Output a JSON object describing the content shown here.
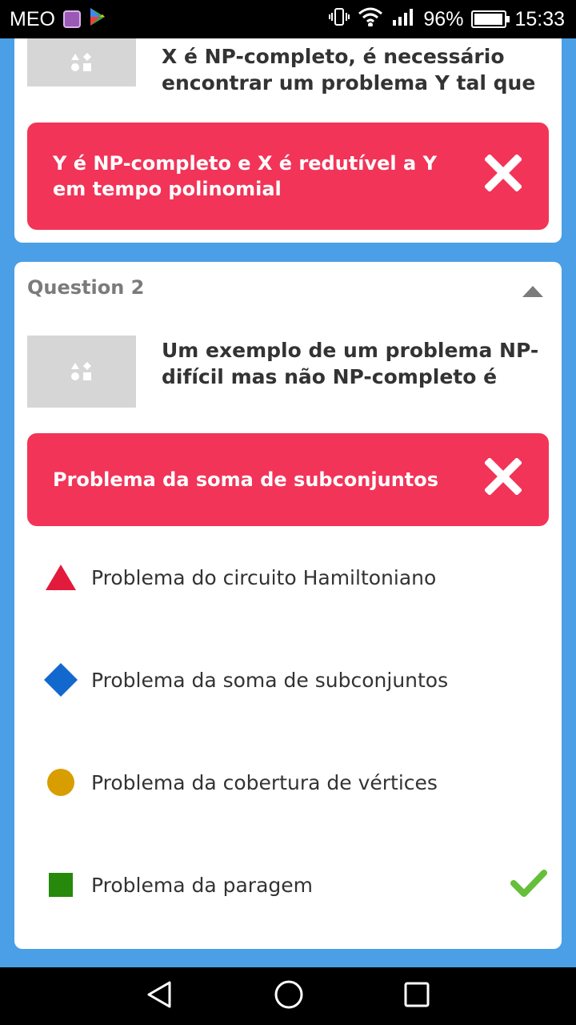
{
  "status_bar": {
    "carrier": "MEO",
    "battery": "96%",
    "battery_level": 0.96,
    "time": "15:33"
  },
  "question1": {
    "text_line1": "X é NP-completo, é necessário",
    "text_line2": "encontrar um problema Y tal que",
    "answer": "Y é NP-completo e X é redutível a Y em tempo polinomial",
    "answer_correct": false
  },
  "question2": {
    "header": "Question 2",
    "text": "Um exemplo de um problema NP-difícil mas não NP-completo é",
    "answer": "Problema da soma de subconjuntos",
    "answer_correct": false,
    "options": [
      {
        "label": "Problema do circuito Hamiltoniano",
        "shape": "triangle",
        "color": "#e21b3c",
        "correct": false
      },
      {
        "label": "Problema da soma de subconjuntos",
        "shape": "diamond",
        "color": "#1368ce",
        "correct": false
      },
      {
        "label": "Problema da cobertura de vértices",
        "shape": "circle",
        "color": "#d89e00",
        "correct": false
      },
      {
        "label": "Problema da paragem",
        "shape": "square",
        "color": "#26890c",
        "correct": true
      }
    ]
  },
  "colors": {
    "background": "#4a9fe6",
    "wrong_answer": "#f23458",
    "check": "#66bf39"
  }
}
